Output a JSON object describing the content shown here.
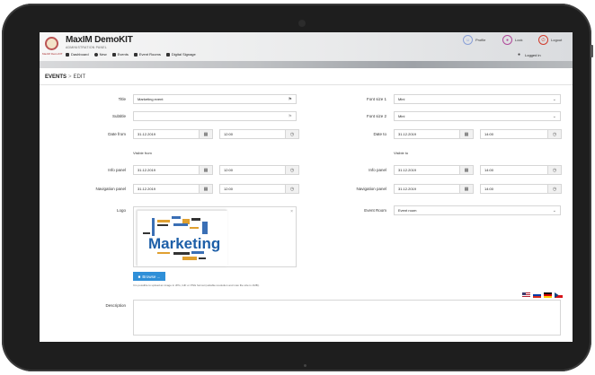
{
  "app": {
    "title": "MaxIM DemoKIT",
    "subtitle": "ADMINISTRATION PANEL",
    "logo_caption": "MaxIM DemoKIT"
  },
  "nav": [
    {
      "label": "Dashboard",
      "icon": "home-icon"
    },
    {
      "label": "New",
      "icon": "plus-circle-icon"
    },
    {
      "label": "Events",
      "icon": "list-icon"
    },
    {
      "label": "Event Rooms",
      "icon": "list-icon"
    },
    {
      "label": "Digital Signage",
      "icon": "grid-icon"
    }
  ],
  "topright": {
    "profile": "Profile",
    "lock": "Lock",
    "logout": "Logout",
    "logged_in": "Logged in"
  },
  "breadcrumb": {
    "section": "EVENTS",
    "separator": ">",
    "page": "EDIT"
  },
  "form": {
    "title_label": "Title",
    "title_value": "Marketing event",
    "subtitle_label": "Subtitle",
    "subtitle_value": "",
    "date_from_label": "Date from",
    "date_from_value": "31.12.2019",
    "date_from_time": "12:00",
    "date_to_label": "Date to",
    "date_to_value": "31.12.2019",
    "date_to_time": "14:00",
    "visible_from": "Visible from",
    "visible_to": "Visible to",
    "info_panel_label": "Info panel",
    "info_from_date": "31.12.2019",
    "info_from_time": "12:00",
    "info_to_date": "31.12.2019",
    "info_to_time": "14:00",
    "nav_panel_label": "Navigation panel",
    "nav_from_date": "31.12.2019",
    "nav_from_time": "12:00",
    "nav_to_date": "31.12.2019",
    "nav_to_time": "14:00",
    "font1_label": "Font size 1",
    "font1_value": "Mini",
    "font2_label": "Font size 2",
    "font2_value": "Mini",
    "logo_label": "Logo",
    "event_room_label": "Event Room",
    "event_room_value": "Event room",
    "browse_label": "Browse ...",
    "upload_hint": "It is possible to upload an image in JPG, GIF or PNG format (suitable resolution and max file size is 1MB).",
    "description_label": "Description",
    "logo_image_text": "Marketing"
  },
  "colors": {
    "accent": "#2f8fd8",
    "profile": "#8aa0d8",
    "lock": "#b04a9a",
    "logout": "#d23b2b"
  },
  "flags": [
    "us-flag",
    "ru-flag",
    "de-flag",
    "cz-flag"
  ]
}
